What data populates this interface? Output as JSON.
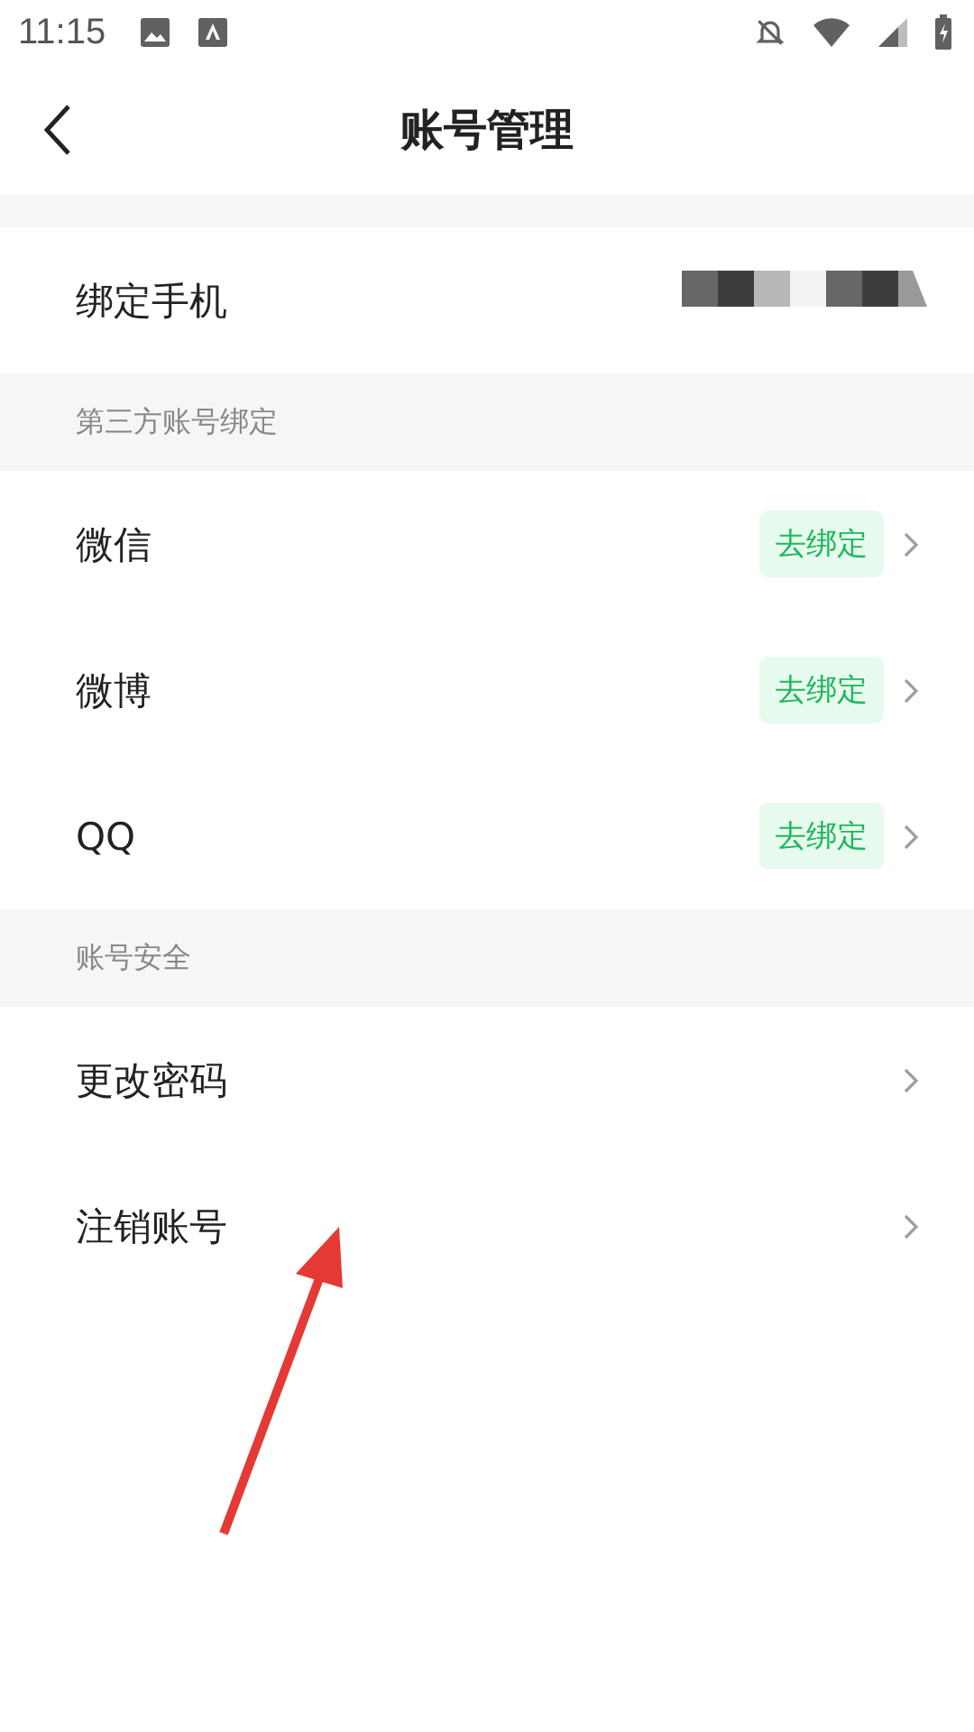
{
  "status_bar": {
    "time": "11:15"
  },
  "header": {
    "title": "账号管理"
  },
  "phone_row": {
    "label": "绑定手机"
  },
  "sections": [
    {
      "title": "第三方账号绑定",
      "rows": [
        {
          "label": "微信",
          "action": "去绑定"
        },
        {
          "label": "微博",
          "action": "去绑定"
        },
        {
          "label": "QQ",
          "action": "去绑定"
        }
      ]
    },
    {
      "title": "账号安全",
      "rows": [
        {
          "label": "更改密码"
        },
        {
          "label": "注销账号"
        }
      ]
    }
  ]
}
